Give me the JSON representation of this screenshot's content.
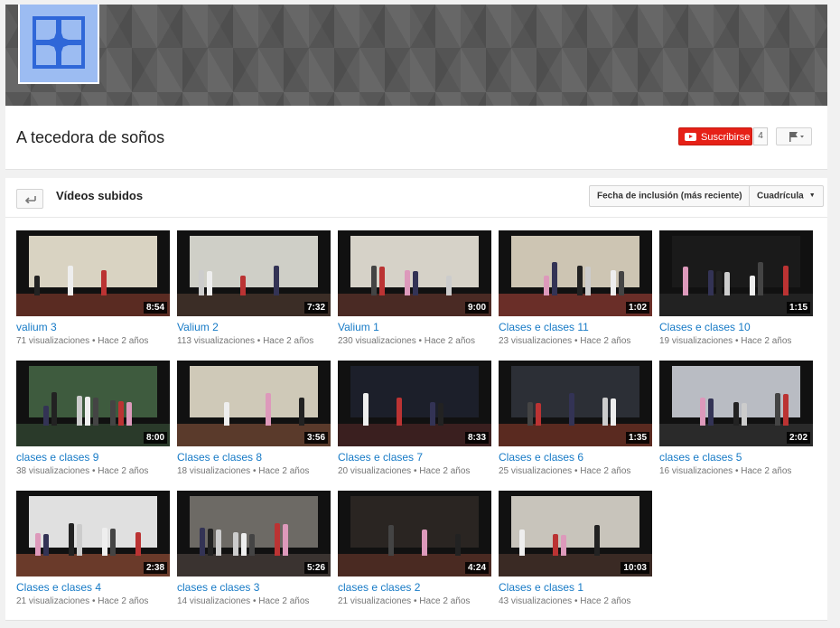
{
  "channel": {
    "name": "A tecedora de soños",
    "subscribe_label": "Suscribirse",
    "subscriber_count": "4",
    "colors": {
      "subscribe": "#e62117",
      "link": "#167ac6",
      "avatar": "#9cbcf2"
    }
  },
  "section": {
    "title": "Vídeos subidos",
    "sort_label": "Fecha de inclusión (más reciente)",
    "view_label": "Cuadrícula",
    "back_icon": "back-arrow-icon",
    "flag_icon": "flag-icon"
  },
  "meta_separator": "•",
  "videos": [
    {
      "title": "valium 3",
      "duration": "8:54",
      "views": "71 visualizaciones",
      "age": "Hace 2 años"
    },
    {
      "title": "Valium 2",
      "duration": "7:32",
      "views": "113 visualizaciones",
      "age": "Hace 2 años"
    },
    {
      "title": "Valium 1",
      "duration": "9:00",
      "views": "230 visualizaciones",
      "age": "Hace 2 años"
    },
    {
      "title": "Clases e clases 11",
      "duration": "1:02",
      "views": "23 visualizaciones",
      "age": "Hace 2 años"
    },
    {
      "title": "Clases e clases 10",
      "duration": "1:15",
      "views": "19 visualizaciones",
      "age": "Hace 2 años"
    },
    {
      "title": "clases e clases 9",
      "duration": "8:00",
      "views": "38 visualizaciones",
      "age": "Hace 2 años"
    },
    {
      "title": "Clases e clases 8",
      "duration": "3:56",
      "views": "18 visualizaciones",
      "age": "Hace 2 años"
    },
    {
      "title": "Clases e clases 7",
      "duration": "8:33",
      "views": "20 visualizaciones",
      "age": "Hace 2 años"
    },
    {
      "title": "Clases e clases 6",
      "duration": "1:35",
      "views": "25 visualizaciones",
      "age": "Hace 2 años"
    },
    {
      "title": "clases e clases 5",
      "duration": "2:02",
      "views": "16 visualizaciones",
      "age": "Hace 2 años"
    },
    {
      "title": "Clases e clases 4",
      "duration": "2:38",
      "views": "21 visualizaciones",
      "age": "Hace 2 años"
    },
    {
      "title": "clases e clases 3",
      "duration": "5:26",
      "views": "14 visualizaciones",
      "age": "Hace 2 años"
    },
    {
      "title": "clases e clases 2",
      "duration": "4:24",
      "views": "21 visualizaciones",
      "age": "Hace 2 años"
    },
    {
      "title": "Clases e clases 1",
      "duration": "10:03",
      "views": "43 visualizaciones",
      "age": "Hace 2 años"
    }
  ]
}
